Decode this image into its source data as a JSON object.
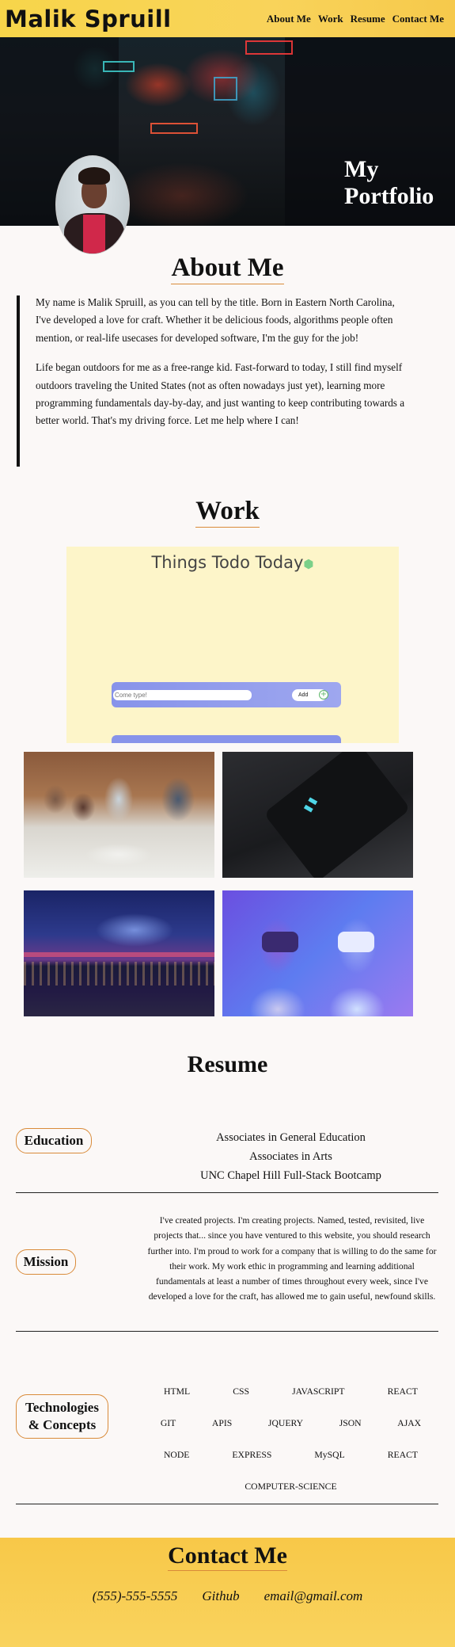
{
  "header": {
    "brand": "Malik Spruill",
    "nav": [
      "About Me",
      "Work",
      "Resume",
      "Contact Me"
    ]
  },
  "hero": {
    "title_line1": "My",
    "title_line2": "Portfolio"
  },
  "about": {
    "title": "About Me",
    "paragraphs": [
      "My name is Malik Spruill, as you can tell by the title. Born in Eastern North Carolina, I've developed a love for craft. Whether it be delicious foods, algorithms people often mention, or real-life usecases for developed software, I'm the guy for the job!",
      "Life began outdoors for me as a free-range kid. Fast-forward to today, I still find myself outdoors traveling the United States (not as often nowadays just yet), learning more programming fundamentals day-by-day, and just wanting to keep contributing towards a better world. That's my driving force. Let me help where I can!"
    ]
  },
  "work": {
    "title": "Work",
    "todo_preview": {
      "title": "Things Todo Today",
      "input_placeholder": "Come type!",
      "add_label": "Add"
    }
  },
  "resume": {
    "title": "Resume",
    "education": {
      "label": "Education",
      "items": [
        "Associates in General Education",
        "Associates in Arts",
        "UNC Chapel Hill Full-Stack Bootcamp"
      ]
    },
    "mission": {
      "label": "Mission",
      "text": "I've created projects. I'm creating projects. Named, tested, revisited, live projects that... since you have ventured to this website, you should research further into. I'm proud to work for a company that is willing to do the same for their work. My work ethic in programming and learning additional fundamentals at least a number of times throughout every week, since I've developed a love for the craft, has allowed me to gain useful, newfound skills."
    },
    "technologies": {
      "label_line1": "Technologies",
      "label_line2": "& Concepts",
      "rows": [
        [
          "HTML",
          "CSS",
          "JAVASCRIPT",
          "REACT"
        ],
        [
          "GIT",
          "APIS",
          "JQUERY",
          "JSON",
          "AJAX"
        ],
        [
          "NODE",
          "EXPRESS",
          "MySQL",
          "REACT"
        ],
        [
          "COMPUTER-SCIENCE"
        ]
      ]
    }
  },
  "contact": {
    "title": "Contact Me",
    "phone": "(555)-555-5555",
    "github": "Github",
    "email": "email@gmail.com"
  },
  "colors": {
    "header_yellow": "#f7d54a",
    "accent_orange": "#d98b3a",
    "background": "#fbf8f7",
    "todo_purple": "#8793ea"
  }
}
